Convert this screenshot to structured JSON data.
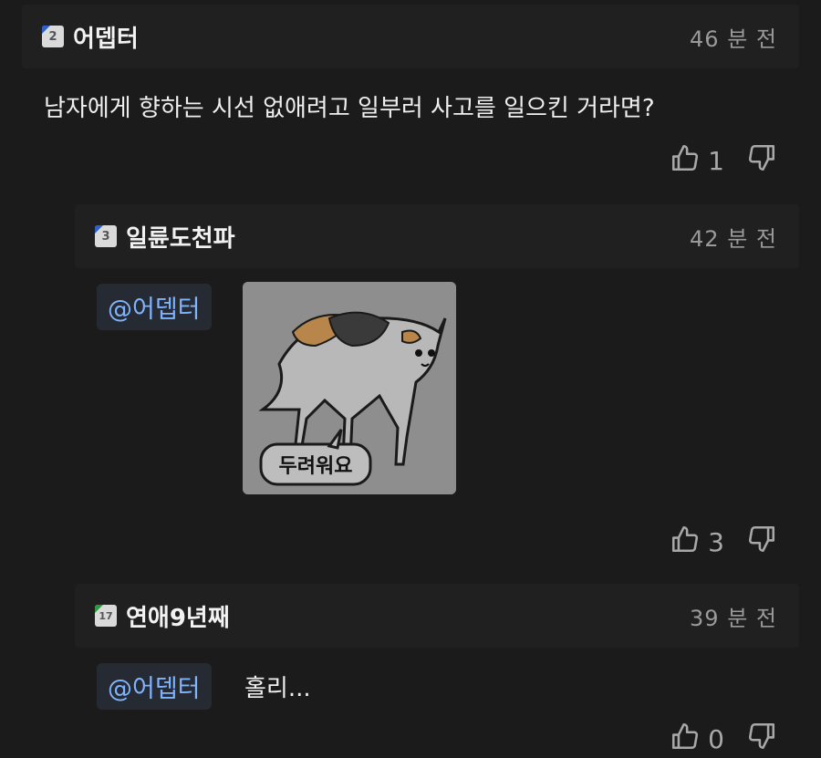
{
  "comments": [
    {
      "level": "2",
      "level_color": "#2f5fc9",
      "username": "어뎁터",
      "time": "46 분 전",
      "text": "남자에게 향하는 시선 없애려고 일부러 사고를 일으킨 거라면?",
      "likes": "1"
    },
    {
      "level": "3",
      "level_color": "#2f5fc9",
      "username": "일륜도천파",
      "time": "42 분 전",
      "mention": "@어뎁터",
      "sticker": {
        "icon": "scared-cat-sticker",
        "caption": "두려워요"
      },
      "likes": "3"
    },
    {
      "level": "17",
      "level_color": "#2e9a3e",
      "username": "연애9년째",
      "time": "39 분 전",
      "mention": "@어뎁터",
      "text": "홀리...",
      "likes": "0"
    }
  ],
  "icons": {
    "like": "thumbs-up-icon",
    "dislike": "thumbs-down-icon"
  }
}
